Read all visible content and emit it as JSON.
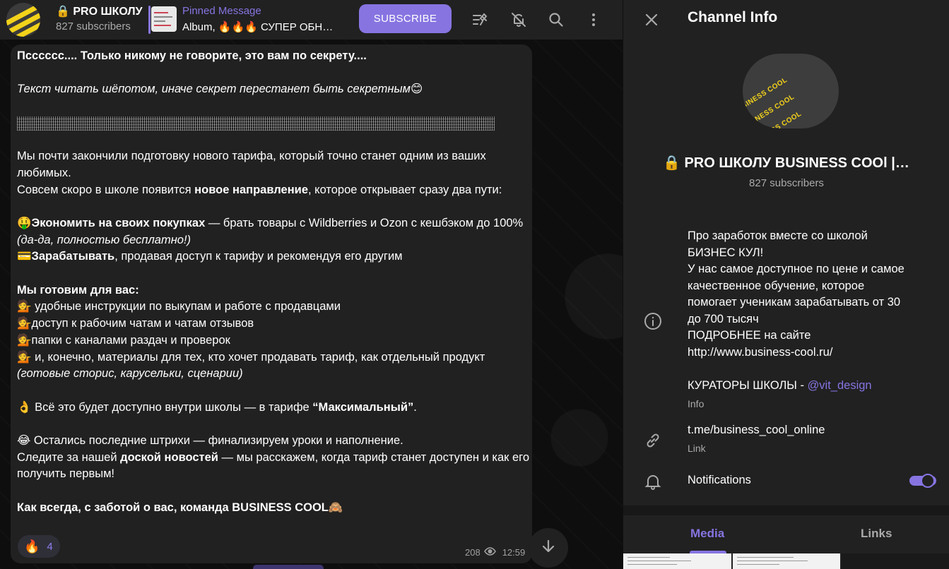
{
  "header": {
    "channel_title": "🔒 PRO ШКОЛУ",
    "subscribers": "827 subscribers",
    "pinned_label": "Pinned Message",
    "pinned_text": "Album, 🔥🔥🔥 СУПЕР ОБНО...",
    "subscribe_label": "SUBSCRIBE"
  },
  "message": {
    "line1": "Псссссс.... Только никому не говорите, это вам по секрету....",
    "line2": "Текст читать шёпотом, иначе секрет перестанет быть секретным😊",
    "p1a": "Мы почти закончили подготовку нового тарифа, который точно станет одним из ваших любимых.",
    "p1b_pre": "Совсем скоро в школе появится ",
    "p1b_bold": "новое направление",
    "p1b_post": ", которое открывает сразу два пути:",
    "b1_emoji": "🤑",
    "b1_bold": "Экономить на своих покупках",
    "b1_text": " — брать товары с Wildberries и Ozon с кешбэком до 100% ",
    "b1_italic": "(да-да, полностью бесплатно!)",
    "b2_emoji": "💳",
    "b2_bold": "Зарабатывать",
    "b2_text": ", продавая доступ к тарифу и рекомендуя его другим",
    "prep_title": "Мы готовим для вас:",
    "prep1": "💁 удобные инструкции по выкупам и работе с продавцами",
    "prep2": "💁доступ к рабочим чатам и чатам отзывов",
    "prep3": "💁папки с каналами раздач и проверок",
    "prep4_text": "💁 и, конечно, материалы для тех, кто хочет продавать тариф, как отдельный продукт ",
    "prep4_italic": "(готовые сторис, карусельки, сценарии)",
    "ok_text": "👌 Всё это будет доступно внутри школы — в тарифе ",
    "ok_bold": "“Максимальный”",
    "ok_end": ".",
    "last1": "😂 Остались последние штрихи — финализируем уроки и наполнение.",
    "last2_pre": "Следите за нашей ",
    "last2_bold": "доской новостей",
    "last2_post": " — мы расскажем, когда тариф станет доступен и как его получить первым!",
    "sign": "Как всегда, с заботой о вас, команда BUSINESS COOL🙈",
    "reaction_emoji": "🔥",
    "reaction_count": "4",
    "views": "208",
    "time": "12:59"
  },
  "panel": {
    "title": "Channel Info",
    "channel_name": "🔒 PRO ШКОЛУ BUSINESS COOl | O...",
    "subscribers": "827 subscribers",
    "avatar_text": "BUSINESS COOL",
    "desc_lines": [
      "Про заработок вместе со школой",
      "БИЗНЕС КУЛ!",
      "У нас самое доступное по цене и самое",
      "качественное обучение, которое",
      "помогает ученикам зарабатывать от 30",
      "до 700 тысяч",
      "ПОДРОБНЕЕ на сайте",
      "http://www.business-cool.ru/"
    ],
    "curators_pre": "КУРАТОРЫ ШКОЛЫ -  ",
    "curators_mention": "@vit_design",
    "info_label": "Info",
    "link_value": "t.me/business_cool_online",
    "link_label": "Link",
    "notifications_label": "Notifications",
    "notifications_on": true,
    "tabs": [
      "Media",
      "Links"
    ]
  },
  "colors": {
    "accent": "#8774e1",
    "panel": "#212121",
    "bg": "#0f0f0f",
    "muted": "#aaaaaa"
  },
  "icons": [
    "close-icon",
    "pinned-list-icon",
    "mute-icon",
    "search-icon",
    "more-icon",
    "info-icon",
    "link-icon",
    "bell-icon",
    "eye-icon",
    "arrow-down-icon"
  ]
}
